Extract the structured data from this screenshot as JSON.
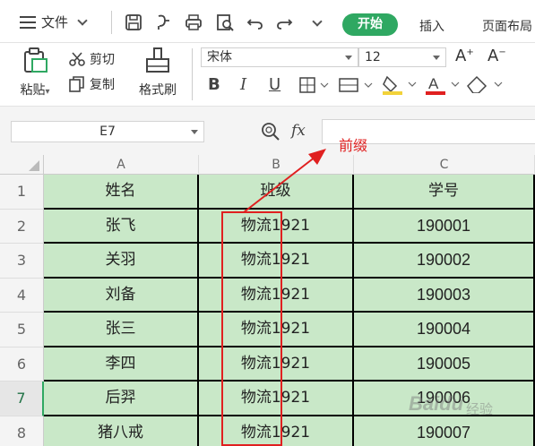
{
  "toolbar": {
    "file_menu": "文件",
    "tabs": [
      "开始",
      "插入",
      "页面布局"
    ]
  },
  "ribbon": {
    "paste": "粘贴",
    "cut": "剪切",
    "copy": "复制",
    "format_painter": "格式刷",
    "font_name": "宋体",
    "font_size": "12"
  },
  "formula_bar": {
    "cell_ref": "E7",
    "fx_label": "fx",
    "formula": ""
  },
  "annotation": {
    "label": "前缀",
    "color": "#e02020"
  },
  "sheet": {
    "columns": [
      "A",
      "B",
      "C"
    ],
    "rows": [
      {
        "num": "1",
        "a": "姓名",
        "b": "班级",
        "c": "学号"
      },
      {
        "num": "2",
        "a": "张飞",
        "b": "物流1921",
        "c": "190001"
      },
      {
        "num": "3",
        "a": "关羽",
        "b": "物流1921",
        "c": "190002"
      },
      {
        "num": "4",
        "a": "刘备",
        "b": "物流1921",
        "c": "190003"
      },
      {
        "num": "5",
        "a": "张三",
        "b": "物流1921",
        "c": "190004"
      },
      {
        "num": "6",
        "a": "李四",
        "b": "物流1921",
        "c": "190005"
      },
      {
        "num": "7",
        "a": "后羿",
        "b": "物流1921",
        "c": "190006"
      },
      {
        "num": "8",
        "a": "猪八戒",
        "b": "物流1921",
        "c": "190007"
      }
    ],
    "active_row": "7",
    "cell_fill": "#c9e8c8"
  },
  "watermark": {
    "brand": "Baidu",
    "suffix": "经验"
  }
}
